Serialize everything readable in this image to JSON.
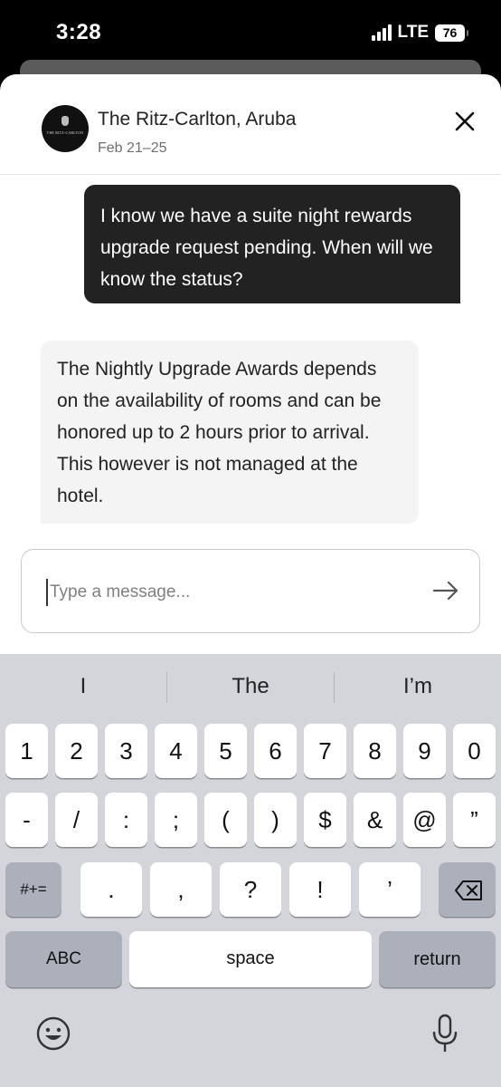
{
  "status_bar": {
    "time": "3:28",
    "network": "LTE",
    "battery": "76"
  },
  "header": {
    "hotel_name": "The Ritz-Carlton, Aruba",
    "dates": "Feb 21–25",
    "avatar_text": "THE RITZ-CARLTON"
  },
  "messages": [
    {
      "from": "guest",
      "text": "I know we have a suite night rewards upgrade request pending. When will we know the status?"
    },
    {
      "from": "hotel",
      "text": "The Nightly Upgrade Awards depends on the availability of rooms and can be honored up to 2 hours prior to arrival. This however is not managed at the hotel."
    }
  ],
  "composer": {
    "placeholder": "Type a message...",
    "value": ""
  },
  "keyboard": {
    "suggestions": [
      "I",
      "The",
      "I’m"
    ],
    "row1": [
      "1",
      "2",
      "3",
      "4",
      "5",
      "6",
      "7",
      "8",
      "9",
      "0"
    ],
    "row2": [
      "-",
      "/",
      ":",
      ";",
      "(",
      ")",
      "$",
      "&",
      "@",
      "”"
    ],
    "row3_toggle": "#+=",
    "row3": [
      ".",
      ",",
      "?",
      "!",
      "’"
    ],
    "abc": "ABC",
    "space": "space",
    "return": "return"
  },
  "icons": [
    "close-icon",
    "send-arrow-icon",
    "backspace-icon",
    "emoji-icon",
    "microphone-icon"
  ]
}
